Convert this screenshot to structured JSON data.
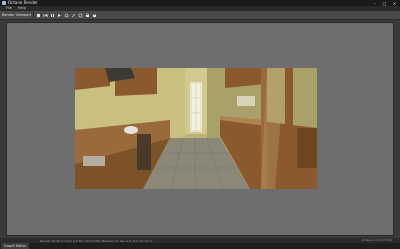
{
  "window": {
    "title": "Octane Render",
    "minimize": "–",
    "maximize": "□",
    "close": "✕"
  },
  "menu": {
    "items": [
      "File",
      "Help"
    ]
  },
  "toolbar": {
    "label": "Render Viewport"
  },
  "statusbar": {
    "left": "Render 00:00:41  Spp 1/0  Tris 1452/1452  Meshes 1/1  Gpu 1/1  Out-of-core 0",
    "right": "Octane 1.0 GTX 580"
  },
  "bottom_tab": {
    "label": "Graph Editor"
  },
  "colors": {
    "accent": "#9fbde0",
    "viewport_bg": "#6e6e6e"
  }
}
